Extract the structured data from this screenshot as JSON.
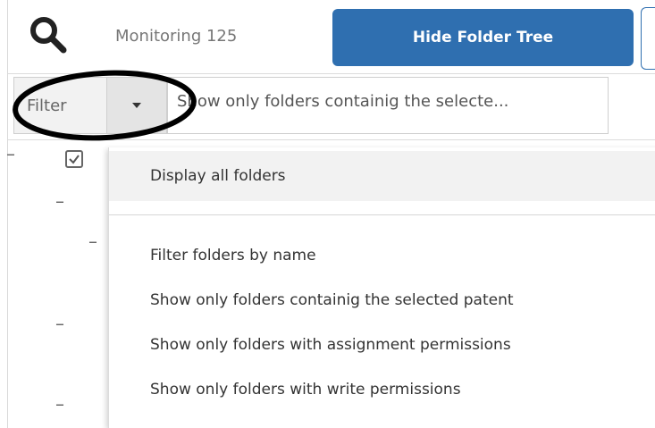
{
  "header": {
    "monitoring_label": "Monitoring 125",
    "hide_tree_button": "Hide Folder Tree"
  },
  "filter": {
    "label": "Filter",
    "current_value": "Show only folders containig the selecte..."
  },
  "dropdown": {
    "items": [
      "Display all folders",
      "Filter folders by name",
      "Show only folders containig the selected patent",
      "Show only folders with assignment permissions",
      "Show only folders with write permissions"
    ]
  },
  "colors": {
    "accent": "#2f6fb0",
    "annotation": "#000000"
  },
  "icons": [
    "search-icon",
    "chevron-down-icon",
    "checkbox-checked-icon",
    "collapse-icon"
  ]
}
